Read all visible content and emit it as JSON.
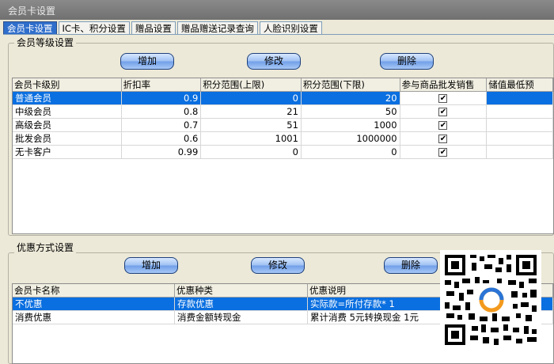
{
  "window": {
    "title": "会员卡设置"
  },
  "tabs": [
    {
      "label": "会员卡设置",
      "active": true
    },
    {
      "label": "IC卡、积分设置"
    },
    {
      "label": "赠品设置"
    },
    {
      "label": "赠品赠送记录查询"
    },
    {
      "label": "人脸识别设置"
    }
  ],
  "levels": {
    "group_title": "会员等级设置",
    "buttons": {
      "add": "增加",
      "edit": "修改",
      "delete": "删除"
    },
    "columns": [
      "会员卡级别",
      "折扣率",
      "积分范围(上限)",
      "积分范围(下限)",
      "参与商品批发销售",
      "储值最低预"
    ],
    "rows": [
      {
        "name": "普通会员",
        "discount": "0.9",
        "upper": "0",
        "lower": "20",
        "wholesale": true,
        "selected": true
      },
      {
        "name": "中级会员",
        "discount": "0.8",
        "upper": "21",
        "lower": "50",
        "wholesale": true
      },
      {
        "name": "高级会员",
        "discount": "0.7",
        "upper": "51",
        "lower": "1000",
        "wholesale": true
      },
      {
        "name": "批发会员",
        "discount": "0.6",
        "upper": "1001",
        "lower": "1000000",
        "wholesale": true
      },
      {
        "name": "无卡客户",
        "discount": "0.99",
        "upper": "0",
        "lower": "0",
        "wholesale": true
      }
    ]
  },
  "offers": {
    "group_title": "优惠方式设置",
    "buttons": {
      "add": "增加",
      "edit": "修改",
      "delete": "删除"
    },
    "columns": [
      "会员卡名称",
      "优惠种类",
      "优惠说明"
    ],
    "rows": [
      {
        "name": "不优惠",
        "type": "存款优惠",
        "desc": "实际款=所付存款* 1",
        "selected": true
      },
      {
        "name": "消费优惠",
        "type": "消费金额转现金",
        "desc": "累计消费 5元转换现金 1元"
      }
    ]
  },
  "colors": {
    "selection": "#0a6fe0",
    "active_tab": "#2f6ecb",
    "button": "#9dc0f2"
  },
  "icons": {
    "checkmark": "check-icon",
    "qr": "qr-code-icon"
  }
}
